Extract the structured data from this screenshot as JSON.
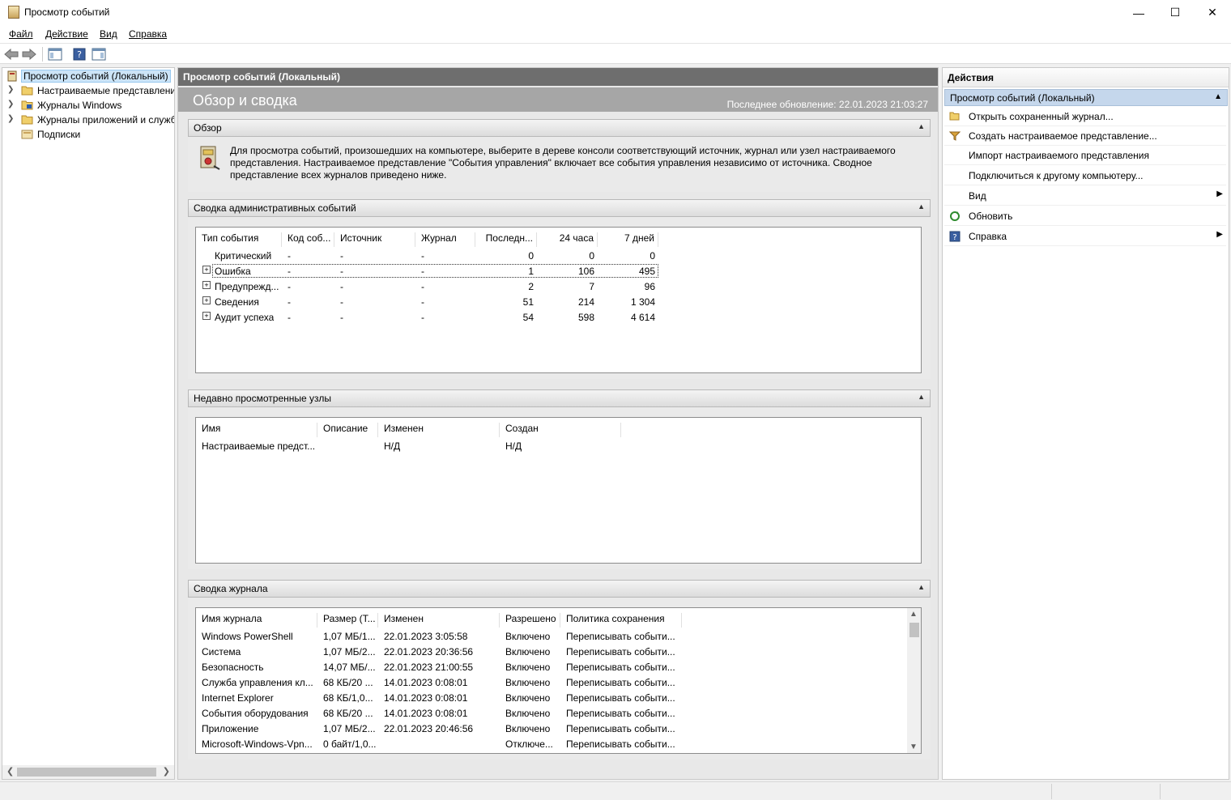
{
  "window": {
    "title": "Просмотр событий"
  },
  "menu": [
    "Файл",
    "Действие",
    "Вид",
    "Справка"
  ],
  "tree": {
    "items": [
      {
        "label": "Просмотр событий (Локальный)",
        "selected": true,
        "chevron": false
      },
      {
        "label": "Настраиваемые представления",
        "selected": false,
        "chevron": true
      },
      {
        "label": "Журналы Windows",
        "selected": false,
        "chevron": true
      },
      {
        "label": "Журналы приложений и служб",
        "selected": false,
        "chevron": true
      },
      {
        "label": "Подписки",
        "selected": false,
        "chevron": false
      }
    ]
  },
  "center": {
    "header": "Просмотр событий (Локальный)",
    "overview_title": "Обзор и сводка",
    "last_update": "Последнее обновление: 22.01.2023 21:03:27",
    "overview": {
      "title": "Обзор",
      "text": "Для просмотра событий, произошедших на компьютере, выберите в дереве консоли соответствующий источник, журнал или узел настраиваемого представления. Настраиваемое представление \"События управления\" включает все события управления независимо от источника. Сводное представление всех журналов приведено ниже."
    },
    "admin_summary": {
      "title": "Сводка административных событий",
      "columns": [
        "Тип события",
        "Код соб...",
        "Источник",
        "Журнал",
        "Последн...",
        "24 часа",
        "7 дней"
      ],
      "rows": [
        {
          "type": "Критический",
          "code": "-",
          "source": "-",
          "log": "-",
          "last": "0",
          "day": "0",
          "week": "0",
          "expand": false
        },
        {
          "type": "Ошибка",
          "code": "-",
          "source": "-",
          "log": "-",
          "last": "1",
          "day": "106",
          "week": "495",
          "expand": true
        },
        {
          "type": "Предупрежд...",
          "code": "-",
          "source": "-",
          "log": "-",
          "last": "2",
          "day": "7",
          "week": "96",
          "expand": true
        },
        {
          "type": "Сведения",
          "code": "-",
          "source": "-",
          "log": "-",
          "last": "51",
          "day": "214",
          "week": "1 304",
          "expand": true
        },
        {
          "type": "Аудит успеха",
          "code": "-",
          "source": "-",
          "log": "-",
          "last": "54",
          "day": "598",
          "week": "4 614",
          "expand": true
        }
      ]
    },
    "recent_nodes": {
      "title": "Недавно просмотренные узлы",
      "columns": [
        "Имя",
        "Описание",
        "Изменен",
        "Создан"
      ],
      "rows": [
        {
          "name": "Настраиваемые предст...",
          "desc": "",
          "modified": "Н/Д",
          "created": "Н/Д"
        }
      ]
    },
    "log_summary": {
      "title": "Сводка журнала",
      "columns": [
        "Имя журнала",
        "Размер (Т...",
        "Изменен",
        "Разрешено",
        "Политика сохранения"
      ],
      "rows": [
        {
          "name": "Windows PowerShell",
          "size": "1,07 МБ/1...",
          "modified": "22.01.2023 3:05:58",
          "enabled": "Включено",
          "policy": "Переписывать событи..."
        },
        {
          "name": "Система",
          "size": "1,07 МБ/2...",
          "modified": "22.01.2023 20:36:56",
          "enabled": "Включено",
          "policy": "Переписывать событи..."
        },
        {
          "name": "Безопасность",
          "size": "14,07 МБ/...",
          "modified": "22.01.2023 21:00:55",
          "enabled": "Включено",
          "policy": "Переписывать событи..."
        },
        {
          "name": "Служба управления кл...",
          "size": "68 КБ/20 ...",
          "modified": "14.01.2023 0:08:01",
          "enabled": "Включено",
          "policy": "Переписывать событи..."
        },
        {
          "name": "Internet Explorer",
          "size": "68 КБ/1,0...",
          "modified": "14.01.2023 0:08:01",
          "enabled": "Включено",
          "policy": "Переписывать событи..."
        },
        {
          "name": "События оборудования",
          "size": "68 КБ/20 ...",
          "modified": "14.01.2023 0:08:01",
          "enabled": "Включено",
          "policy": "Переписывать событи..."
        },
        {
          "name": "Приложение",
          "size": "1,07 МБ/2...",
          "modified": "22.01.2023 20:46:56",
          "enabled": "Включено",
          "policy": "Переписывать событи..."
        },
        {
          "name": "Microsoft-Windows-Vpn...",
          "size": "0 байт/1,0...",
          "modified": "",
          "enabled": "Отключе...",
          "policy": "Переписывать событи..."
        }
      ]
    }
  },
  "actions": {
    "title": "Действия",
    "group": "Просмотр событий (Локальный)",
    "items": [
      {
        "label": "Открыть сохраненный журнал...",
        "icon": "folder-open-icon",
        "submenu": false
      },
      {
        "label": "Создать настраиваемое представление...",
        "icon": "filter-icon",
        "submenu": false
      },
      {
        "label": "Импорт настраиваемого представления",
        "icon": "",
        "submenu": false
      },
      {
        "label": "Подключиться к другому компьютеру...",
        "icon": "",
        "submenu": false
      },
      {
        "label": "Вид",
        "icon": "",
        "submenu": true
      },
      {
        "label": "Обновить",
        "icon": "refresh-icon",
        "submenu": false
      },
      {
        "label": "Справка",
        "icon": "help-icon",
        "submenu": true
      }
    ]
  },
  "colors": {
    "selection": "#cce4f7",
    "header_dark": "#6e6e6e",
    "actions_group": "#c5d7ec"
  }
}
